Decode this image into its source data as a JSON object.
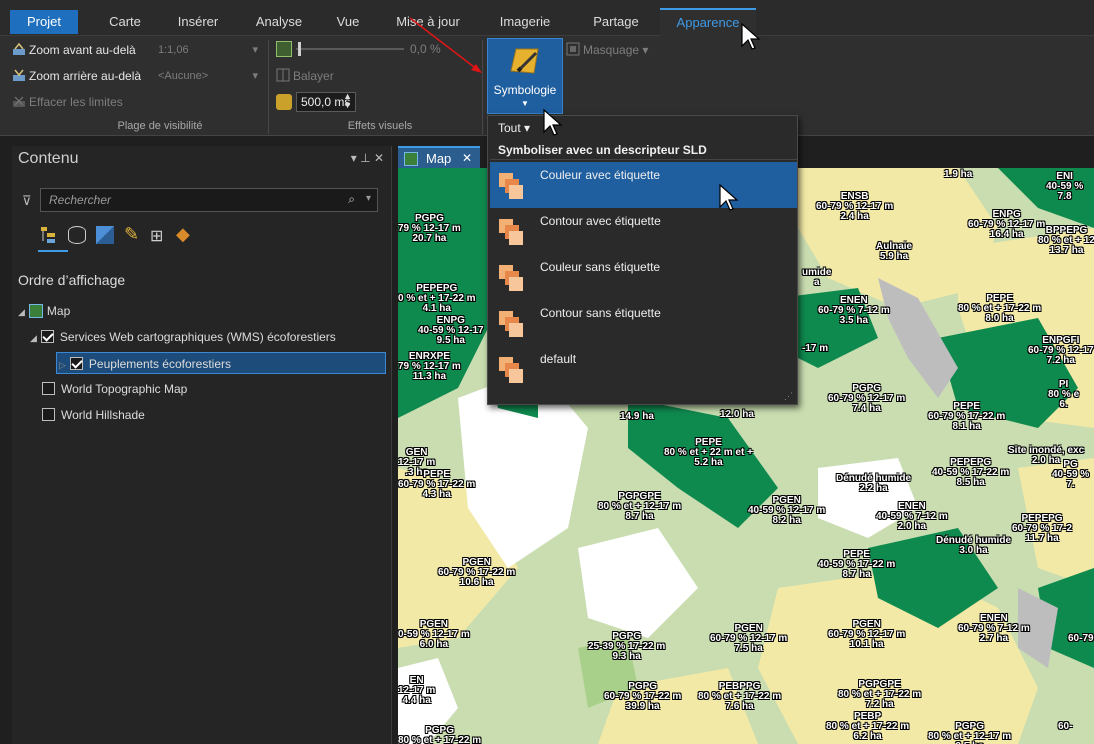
{
  "ribbon": {
    "tabs": [
      {
        "label": "Projet"
      },
      {
        "label": "Carte"
      },
      {
        "label": "Insérer"
      },
      {
        "label": "Analyse"
      },
      {
        "label": "Vue"
      },
      {
        "label": "Mise à jour"
      },
      {
        "label": "Imagerie"
      },
      {
        "label": "Partage"
      },
      {
        "label": "Apparence"
      }
    ],
    "visibility": {
      "zoom_in_label": "Zoom avant au-delà",
      "zoom_in_value": "1:1,06",
      "zoom_out_label": "Zoom arrière au-delà",
      "zoom_out_value": "<Aucune>",
      "clear_label": "Effacer les limites",
      "group_label": "Plage de visibilité"
    },
    "effects": {
      "transparency_value": "0,0 %",
      "swipe_label": "Balayer",
      "flicker_value": "500,0 ms",
      "group_label": "Effets visuels"
    },
    "symbology_label": "Symbologie",
    "masking_label": "Masquage"
  },
  "contents": {
    "title": "Contenu",
    "pin": "▾ ⊥ ✕",
    "search_placeholder": "Rechercher",
    "section_title": "Ordre d’affichage",
    "tree": [
      {
        "label": "Map"
      },
      {
        "label": "Services Web cartographiques (WMS) écoforestiers",
        "checked": true
      },
      {
        "label": "Peuplements écoforestiers",
        "checked": true
      },
      {
        "label": "World Topographic Map",
        "checked": false
      },
      {
        "label": "World Hillshade",
        "checked": false
      }
    ]
  },
  "map_tab": {
    "label": "Map"
  },
  "dropdown": {
    "filter": "Tout",
    "heading": "Symboliser avec un descripteur SLD",
    "items": [
      {
        "label": "Couleur avec étiquette"
      },
      {
        "label": "Contour avec étiquette"
      },
      {
        "label": "Couleur sans étiquette"
      },
      {
        "label": "Contour sans étiquette"
      },
      {
        "label": "default"
      }
    ]
  },
  "map_labels": [
    "PGPG\n79 % 12-17 m\n20.7 ha",
    "PEPEPG\n0 % et + 17-22 m\n4.1 ha",
    "ENPG\n40-59 % 12-17\n9.5 ha",
    "ENRXPE\n79 % 12-17 m\n11.3 ha",
    "ENSB\n60-79 % 12-17 m\n2.4 ha",
    "Aulnaie\n5.9 ha",
    "ENPG\n60-79 % 12-17 m\n16.4 ha",
    "BPPEPG\n80 % et + 12\n13.7 ha",
    "1.9 ha",
    "ENI\n40-59 %\n7.8",
    "-22 m\n3.0 ha",
    "umide\na",
    "ENEN\n60-79 % 7-12 m\n3.5 ha",
    "PEPE\n80 % et + 17-22 m\n8.0 ha",
    "ENPGFI\n60-79 % 12-17\n7.2 ha",
    "-17 m",
    "PGPG\n60-79 % 12-17 m\n7.4 ha",
    "PEPE\n60-79 % 17-22 m\n8.1 ha",
    "PI\n80 % e\n6.",
    "14.9 ha",
    "12.0 ha",
    "PEPE\n80 % et + 22 m et +\n5.2 ha",
    "Site inondé, exc\n2.0 ha",
    "GEN\n12-17 m\n.3 ha",
    "PEPE\n60-79 % 17-22 m\n4.3 ha",
    "Dénudé humide\n2.2 ha",
    "PEPEPG\n40-59 % 17-22 m\n8.5 ha",
    "PG\n40-59 %\n7.",
    "PGPGPE\n80 % et + 12-17 m\n8.7 ha",
    "PGEN\n40-59 % 12-17 m\n8.2 ha",
    "ENEN\n40-59 % 7-12 m\n2.0 ha",
    "Dénudé humide\n3.0 ha",
    "PEPEPG\n60-79 % 17-2\n11.7 ha",
    "PGEN\n60-79 % 17-22 m\n10.6 ha",
    "PEPE\n40-59 % 17-22 m\n8.7 ha",
    "PGEN\n0-59 % 12-17 m\n6.0 ha",
    "PGPG\n25-39 % 17-22 m\n9.3 ha",
    "PGEN\n60-79 % 12-17 m\n7.5 ha",
    "PGEN\n60-79 % 12-17 m\n10.1 ha",
    "ENEN\n60-79 % 7-12 m\n2.7 ha",
    "60-79",
    "EN\n12-17 m\n4.4 ha",
    "PGPG\n60-79 % 17-22 m\n39.9 ha",
    "PEBPPG\n80 % et + 17-22 m\n7.6 ha",
    "PGPGPE\n80 % et + 17-22 m\n7.2 ha",
    "PGPG\n80 % et + 17-22 m",
    "PEBP\n80 % et + 17-22 m\n6.2 ha",
    "PGPG\n80 % et + 12-17 m\n2.5 ha",
    "60-"
  ]
}
